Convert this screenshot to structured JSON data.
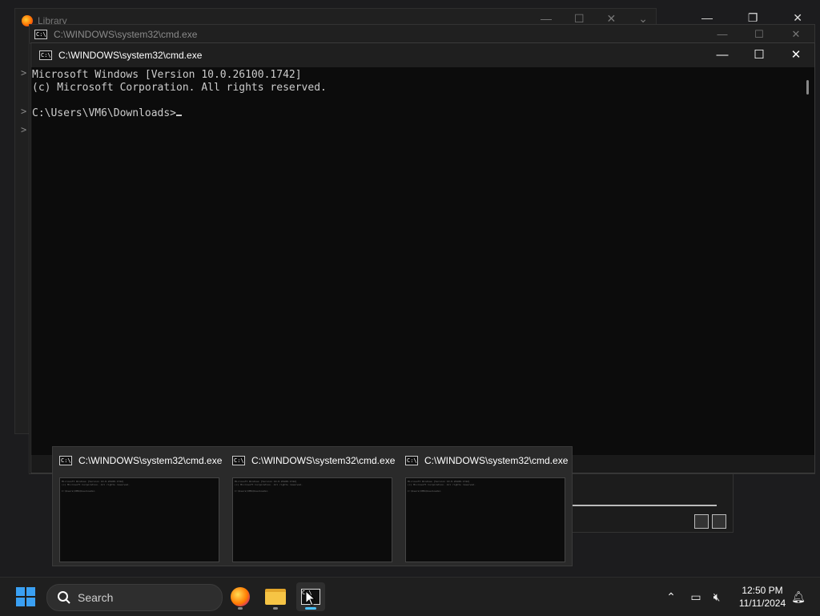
{
  "background_window": {
    "title": "Library"
  },
  "cmd_back": {
    "title": "C:\\WINDOWS\\system32\\cmd.exe"
  },
  "cmd_main": {
    "title": "C:\\WINDOWS\\system32\\cmd.exe",
    "console_lines": [
      "Microsoft Windows [Version 10.0.26100.1742]",
      "(c) Microsoft Corporation. All rights reserved.",
      "",
      "C:\\Users\\VM6\\Downloads>"
    ]
  },
  "previews": [
    {
      "title": "C:\\WINDOWS\\system32\\cmd.exe"
    },
    {
      "title": "C:\\WINDOWS\\system32\\cmd.exe"
    },
    {
      "title": "C:\\WINDOWS\\system32\\cmd.exe"
    }
  ],
  "taskbar": {
    "search_label": "Search",
    "clock_time": "12:50 PM",
    "clock_date": "11/11/2024"
  },
  "colors": {
    "accent": "#4cc2ff",
    "start": "#3aa0f3",
    "console_bg": "#0c0c0c",
    "console_text": "#cccccc"
  }
}
